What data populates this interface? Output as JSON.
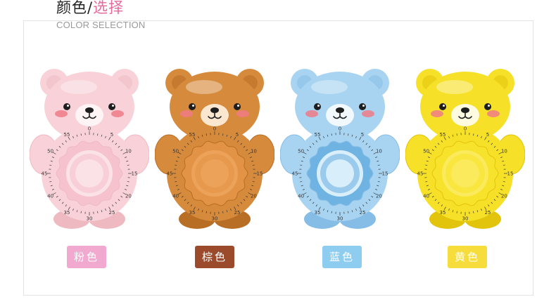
{
  "header": {
    "title_part1": "颜色/",
    "title_part2": "选择",
    "subtitle": "COLOR SELECTION"
  },
  "dial_numbers": [
    "0",
    "5",
    "10",
    "15",
    "20",
    "25",
    "30",
    "35",
    "40",
    "45",
    "50",
    "55"
  ],
  "products": [
    {
      "name": "粉色",
      "label_color": "#f1a9cf",
      "body": "#f8d2d8",
      "dark": "#efb9c2",
      "dial": "#f6c2ce",
      "dial_center": "#fbe2e7",
      "muzzle": "#fff4f5"
    },
    {
      "name": "棕色",
      "label_color": "#9b4b2b",
      "body": "#d68a3c",
      "dark": "#b96e25",
      "dial": "#e39345",
      "dial_center": "#eda25a",
      "muzzle": "#fbe6cf"
    },
    {
      "name": "蓝色",
      "label_color": "#8ecdf0",
      "body": "#a8d4f2",
      "dark": "#86bde6",
      "dial": "#6fb3e3",
      "dial_center": "#d9eefb",
      "muzzle": "#f1f8fe"
    },
    {
      "name": "黄色",
      "label_color": "#f6dd3c",
      "body": "#f6e128",
      "dark": "#e3c40d",
      "dial": "#f8e32c",
      "dial_center": "#fbeb5c",
      "muzzle": "#fffbe0"
    }
  ]
}
